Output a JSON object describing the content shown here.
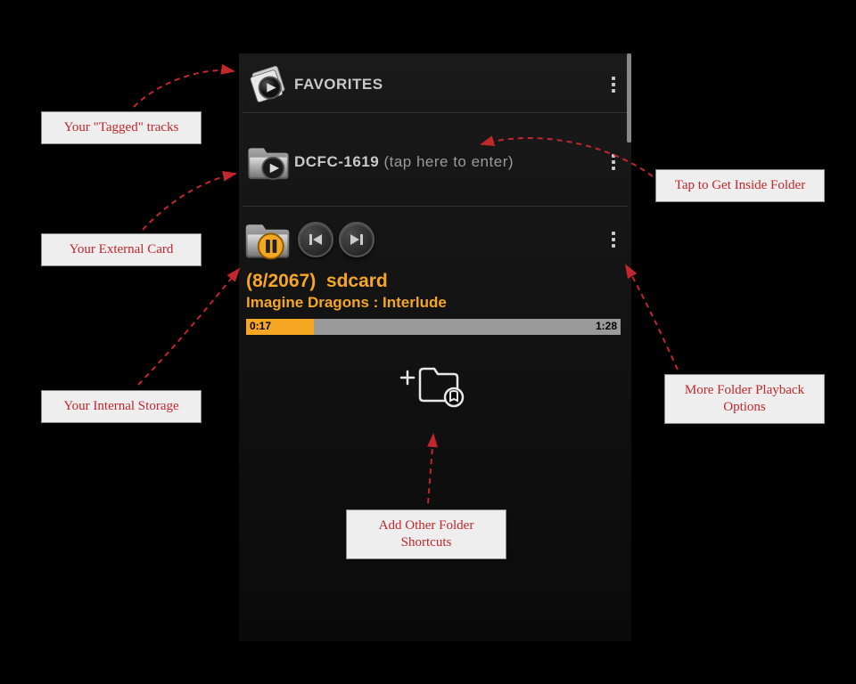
{
  "rows": {
    "favorites": {
      "label": "FAVORITES"
    },
    "folder1": {
      "label": "DCFC-1619",
      "hint": "(tap here to enter)"
    }
  },
  "current": {
    "position": "(8/2067)",
    "dir": "sdcard",
    "track": "Imagine Dragons : Interlude",
    "elapsed": "0:17",
    "duration": "1:28"
  },
  "callouts": {
    "tagged": "Your \"Tagged\" tracks",
    "external": "Your External Card",
    "internal": "Your Internal Storage",
    "enterFolder": "Tap to Get Inside Folder",
    "moreOptions": "More Folder Playback Options",
    "addShortcuts": "Add Other Folder Shortcuts"
  }
}
